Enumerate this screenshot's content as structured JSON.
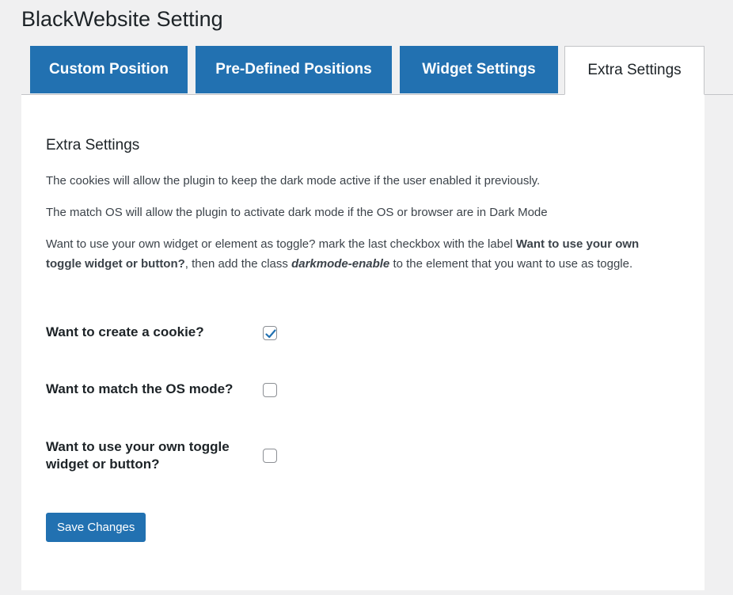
{
  "page_title": "BlackWebsite Setting",
  "tabs": [
    {
      "label": "Custom Position",
      "active": false
    },
    {
      "label": "Pre-Defined Positions",
      "active": false
    },
    {
      "label": "Widget Settings",
      "active": false
    },
    {
      "label": "Extra Settings",
      "active": true
    }
  ],
  "section": {
    "title": "Extra Settings",
    "desc_cookies": "The cookies will allow the plugin to keep the dark mode active if the user enabled it previously.",
    "desc_match_os": "The match OS will allow the plugin to activate dark mode if the OS or browser are in Dark Mode",
    "desc_toggle": {
      "part1": "Want to use your own widget or element as toggle? mark the last checkbox with the label ",
      "bold_label": "Want to use your own toggle widget or button?",
      "part2": ", then add the class ",
      "class_name": "darkmode-enable",
      "part3": " to the element that you want to use as toggle."
    }
  },
  "fields": [
    {
      "label": "Want to create a cookie?",
      "checked": true
    },
    {
      "label": "Want to match the OS mode?",
      "checked": false
    },
    {
      "label": "Want to use your own toggle widget or button?",
      "checked": false
    }
  ],
  "save_label": "Save Changes",
  "colors": {
    "accent": "#2271b1",
    "background": "#f0f0f1",
    "panel": "#ffffff",
    "text": "#1d2327"
  },
  "icons": {
    "checkmark": "checkmark-icon"
  }
}
